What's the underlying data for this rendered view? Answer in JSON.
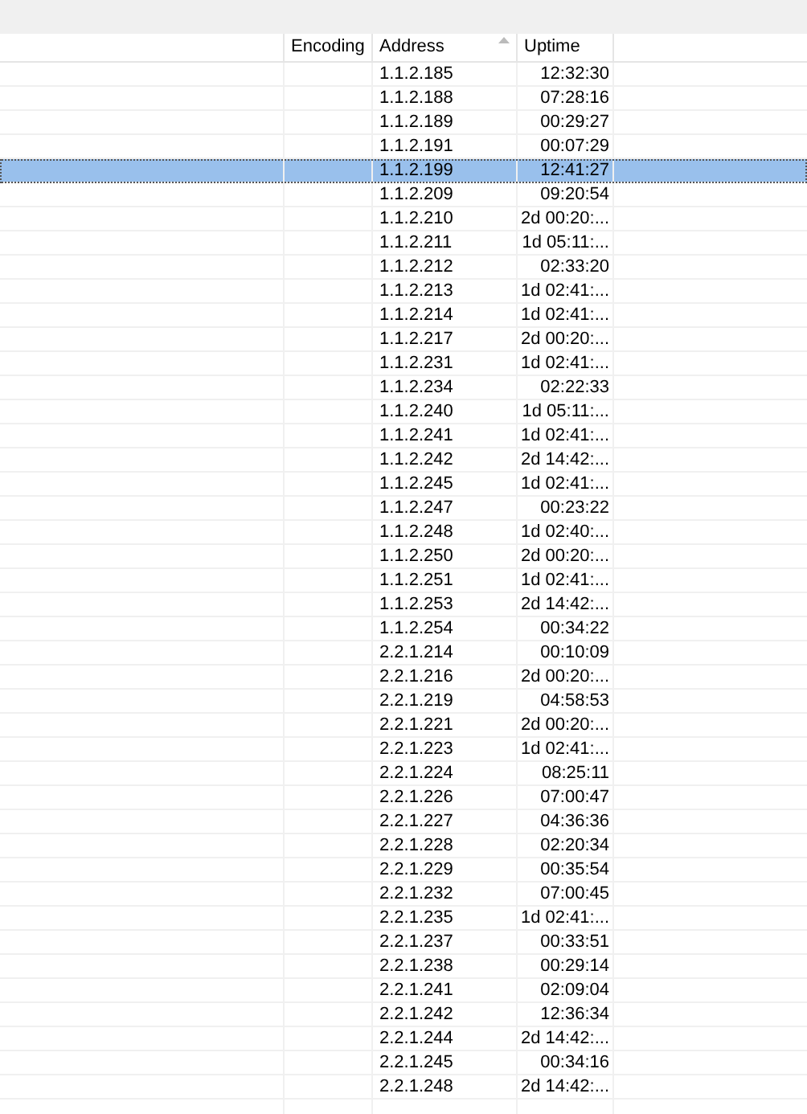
{
  "table": {
    "columns": [
      {
        "sorted": false
      },
      {
        "label": "Encoding",
        "sorted": false
      },
      {
        "label": "Address",
        "sorted": true
      },
      {
        "label": "Uptime",
        "sorted": false
      }
    ],
    "rows": [
      {
        "address": "1.1.2.185",
        "uptime": "12:32:30",
        "selected": false
      },
      {
        "address": "1.1.2.188",
        "uptime": "07:28:16",
        "selected": false
      },
      {
        "address": "1.1.2.189",
        "uptime": "00:29:27",
        "selected": false
      },
      {
        "address": "1.1.2.191",
        "uptime": "00:07:29",
        "selected": false
      },
      {
        "address": "1.1.2.199",
        "uptime": "12:41:27",
        "selected": true
      },
      {
        "address": "1.1.2.209",
        "uptime": "09:20:54",
        "selected": false
      },
      {
        "address": "1.1.2.210",
        "uptime": "2d 00:20:...",
        "selected": false
      },
      {
        "address": "1.1.2.211",
        "uptime": "1d 05:11:...",
        "selected": false
      },
      {
        "address": "1.1.2.212",
        "uptime": "02:33:20",
        "selected": false
      },
      {
        "address": "1.1.2.213",
        "uptime": "1d 02:41:...",
        "selected": false
      },
      {
        "address": "1.1.2.214",
        "uptime": "1d 02:41:...",
        "selected": false
      },
      {
        "address": "1.1.2.217",
        "uptime": "2d 00:20:...",
        "selected": false
      },
      {
        "address": "1.1.2.231",
        "uptime": "1d 02:41:...",
        "selected": false
      },
      {
        "address": "1.1.2.234",
        "uptime": "02:22:33",
        "selected": false
      },
      {
        "address": "1.1.2.240",
        "uptime": "1d 05:11:...",
        "selected": false
      },
      {
        "address": "1.1.2.241",
        "uptime": "1d 02:41:...",
        "selected": false
      },
      {
        "address": "1.1.2.242",
        "uptime": "2d 14:42:...",
        "selected": false
      },
      {
        "address": "1.1.2.245",
        "uptime": "1d 02:41:...",
        "selected": false
      },
      {
        "address": "1.1.2.247",
        "uptime": "00:23:22",
        "selected": false
      },
      {
        "address": "1.1.2.248",
        "uptime": "1d 02:40:...",
        "selected": false
      },
      {
        "address": "1.1.2.250",
        "uptime": "2d 00:20:...",
        "selected": false
      },
      {
        "address": "1.1.2.251",
        "uptime": "1d 02:41:...",
        "selected": false
      },
      {
        "address": "1.1.2.253",
        "uptime": "2d 14:42:...",
        "selected": false
      },
      {
        "address": "1.1.2.254",
        "uptime": "00:34:22",
        "selected": false
      },
      {
        "address": "2.2.1.214",
        "uptime": "00:10:09",
        "selected": false
      },
      {
        "address": "2.2.1.216",
        "uptime": "2d 00:20:...",
        "selected": false
      },
      {
        "address": "2.2.1.219",
        "uptime": "04:58:53",
        "selected": false
      },
      {
        "address": "2.2.1.221",
        "uptime": "2d 00:20:...",
        "selected": false
      },
      {
        "address": "2.2.1.223",
        "uptime": "1d 02:41:...",
        "selected": false
      },
      {
        "address": "2.2.1.224",
        "uptime": "08:25:11",
        "selected": false
      },
      {
        "address": "2.2.1.226",
        "uptime": "07:00:47",
        "selected": false
      },
      {
        "address": "2.2.1.227",
        "uptime": "04:36:36",
        "selected": false
      },
      {
        "address": "2.2.1.228",
        "uptime": "02:20:34",
        "selected": false
      },
      {
        "address": "2.2.1.229",
        "uptime": "00:35:54",
        "selected": false
      },
      {
        "address": "2.2.1.232",
        "uptime": "07:00:45",
        "selected": false
      },
      {
        "address": "2.2.1.235",
        "uptime": "1d 02:41:...",
        "selected": false
      },
      {
        "address": "2.2.1.237",
        "uptime": "00:33:51",
        "selected": false
      },
      {
        "address": "2.2.1.238",
        "uptime": "00:29:14",
        "selected": false
      },
      {
        "address": "2.2.1.241",
        "uptime": "02:09:04",
        "selected": false
      },
      {
        "address": "2.2.1.242",
        "uptime": "12:36:34",
        "selected": false
      },
      {
        "address": "2.2.1.244",
        "uptime": "2d 14:42:...",
        "selected": false
      },
      {
        "address": "2.2.1.245",
        "uptime": "00:34:16",
        "selected": false
      },
      {
        "address": "2.2.1.248",
        "uptime": "2d 14:42:...",
        "selected": false
      }
    ]
  }
}
